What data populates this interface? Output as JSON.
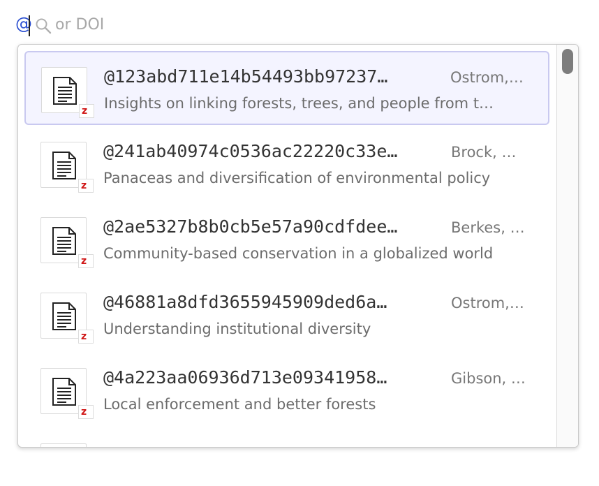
{
  "search": {
    "trigger": "@",
    "placeholder": "or DOI"
  },
  "results": [
    {
      "key": "@123abd711e14b54493bb97237…",
      "author": "Ostrom,…",
      "title": "Insights on linking forests, trees, and people from t…",
      "selected": true
    },
    {
      "key": "@241ab40974c0536ac22220c33e…",
      "author": "Brock, …",
      "title": "Panaceas and diversification of environmental policy",
      "selected": false
    },
    {
      "key": "@2ae5327b8b0cb5e57a90cdfdee…",
      "author": "Berkes, …",
      "title": "Community-based conservation in a globalized world",
      "selected": false
    },
    {
      "key": "@46881a8dfd3655945909ded6a…",
      "author": "Ostrom,…",
      "title": "Understanding institutional diversity",
      "selected": false
    },
    {
      "key": "@4a223aa06936d713e09341958…",
      "author": "Gibson, …",
      "title": "Local enforcement and better forests",
      "selected": false
    }
  ],
  "badge_letter": "z",
  "icons": {
    "item": "document-icon",
    "source": "zotero-badge-icon",
    "search": "search-icon"
  },
  "colors": {
    "at_sign": "#2b4fd1",
    "selected_border": "#c9c9f0",
    "badge": "#d01818"
  }
}
